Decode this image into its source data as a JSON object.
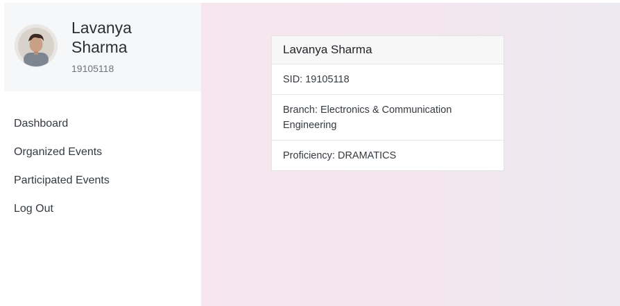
{
  "profile": {
    "name": "Lavanya Sharma",
    "id": "19105118",
    "avatar_icon": "user-photo"
  },
  "nav": {
    "items": [
      {
        "label": "Dashboard"
      },
      {
        "label": "Organized Events"
      },
      {
        "label": "Participated Events"
      },
      {
        "label": "Log Out"
      }
    ]
  },
  "card": {
    "title": "Lavanya Sharma",
    "sid": "SID: 19105118",
    "branch": "Branch: Electronics & Communication Engineering",
    "proficiency": "Proficiency: DRAMATICS"
  },
  "colors": {
    "main_bg_start": "#f7e6ee",
    "main_bg_end": "#ece8ef",
    "profile_bg": "#f6f7f9"
  }
}
